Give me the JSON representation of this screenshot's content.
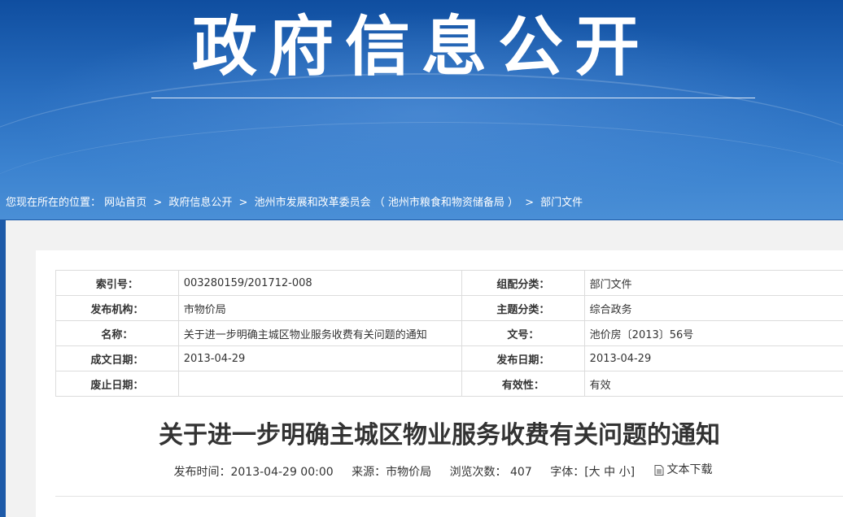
{
  "banner": {
    "title": "政府信息公开"
  },
  "breadcrumb": {
    "prefix": "您现在所在的位置：",
    "items": [
      "网站首页",
      "政府信息公开",
      "池州市发展和改革委员会 （ 池州市粮食和物资储备局 ）",
      "部门文件"
    ],
    "separator": ">"
  },
  "meta": {
    "rows": [
      {
        "k1": "索引号：",
        "v1": "003280159/201712-008",
        "k2": "组配分类：",
        "v2": "部门文件"
      },
      {
        "k1": "发布机构：",
        "v1": "市物价局",
        "k2": "主题分类：",
        "v2": "综合政务"
      },
      {
        "k1": "名称：",
        "v1": "关于进一步明确主城区物业服务收费有关问题的通知",
        "k2": "文号：",
        "v2": "池价房〔2013〕56号"
      },
      {
        "k1": "成文日期：",
        "v1": "2013-04-29",
        "k2": "发布日期：",
        "v2": "2013-04-29"
      },
      {
        "k1": "废止日期：",
        "v1": "",
        "k2": "有效性：",
        "v2": "有效"
      }
    ]
  },
  "article": {
    "title": "关于进一步明确主城区物业服务收费有关问题的通知",
    "publish_time_label": "发布时间：",
    "publish_time": "2013-04-29 00:00",
    "source_label": "来源：",
    "source": "市物价局",
    "views_label": "浏览次数：",
    "views": "407",
    "font_label": "字体：",
    "font_open": "[",
    "font_large": "大",
    "font_medium": "中",
    "font_small": "小",
    "font_close": "]",
    "download_label": "文本下载",
    "download_icon": "document-icon"
  }
}
